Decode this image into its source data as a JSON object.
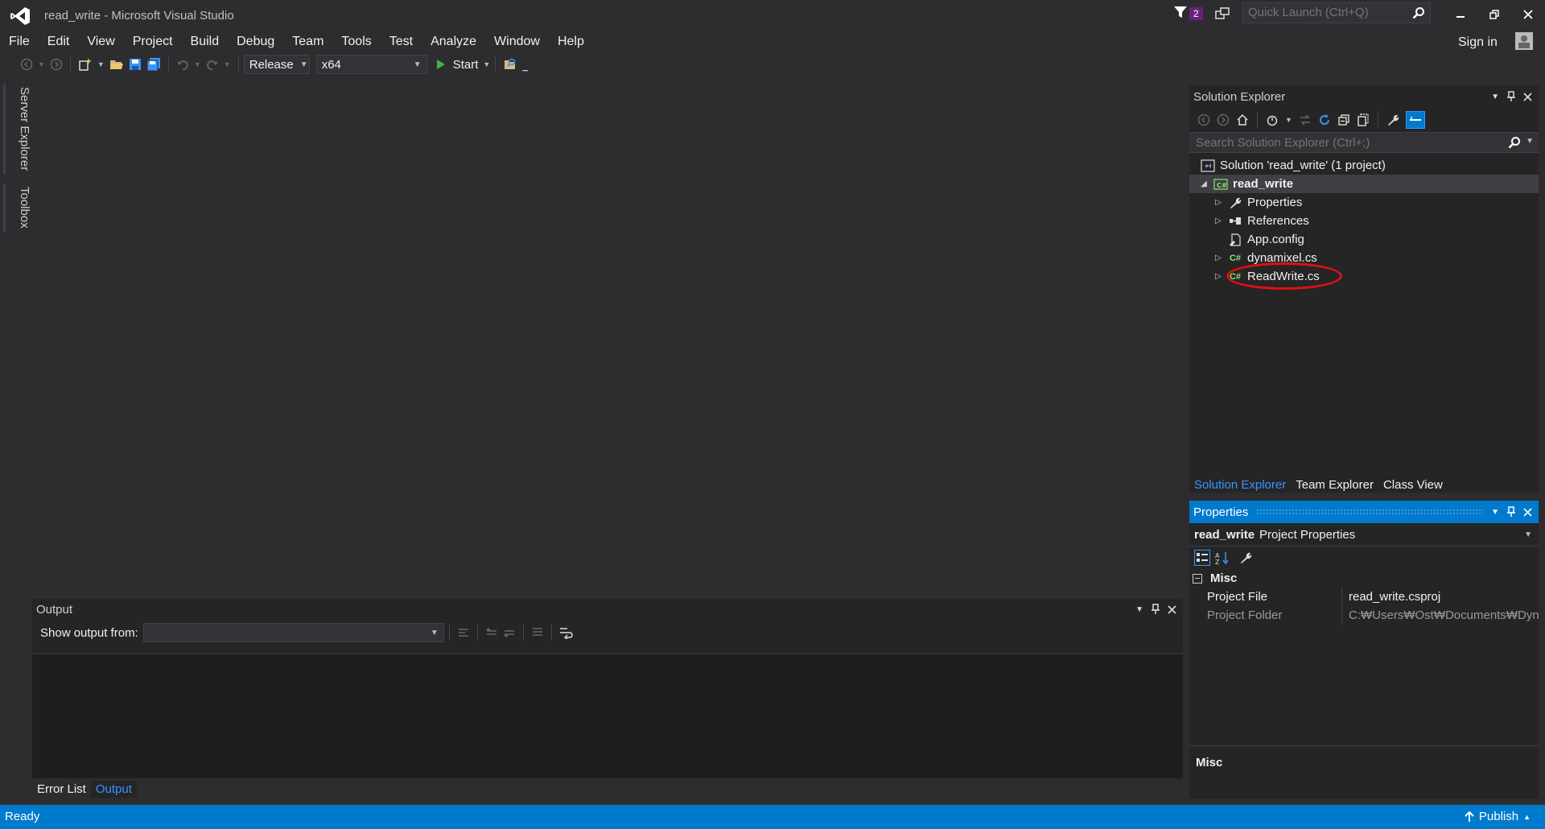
{
  "window": {
    "title": "read_write - Microsoft Visual Studio",
    "notification_count": "2",
    "quick_launch_placeholder": "Quick Launch (Ctrl+Q)",
    "sign_in": "Sign in"
  },
  "menu": {
    "items": [
      "File",
      "Edit",
      "View",
      "Project",
      "Build",
      "Debug",
      "Team",
      "Tools",
      "Test",
      "Analyze",
      "Window",
      "Help"
    ]
  },
  "toolbar": {
    "configuration": "Release",
    "platform": "x64",
    "start_label": "Start"
  },
  "side_tabs": [
    "Server Explorer",
    "Toolbox"
  ],
  "solution_explorer": {
    "title": "Solution Explorer",
    "search_placeholder": "Search Solution Explorer (Ctrl+;)",
    "tree": [
      {
        "label": "Solution 'read_write' (1 project)",
        "icon": "solution-icon"
      },
      {
        "label": "read_write",
        "icon": "csharp-project-icon"
      },
      {
        "label": "Properties",
        "icon": "wrench-icon"
      },
      {
        "label": "References",
        "icon": "references-icon"
      },
      {
        "label": "App.config",
        "icon": "config-file-icon"
      },
      {
        "label": "dynamixel.cs",
        "icon": "csharp-file-icon"
      },
      {
        "label": "ReadWrite.cs",
        "icon": "csharp-file-icon"
      }
    ],
    "bottom_tabs": [
      "Solution Explorer",
      "Team Explorer",
      "Class View"
    ]
  },
  "properties": {
    "title": "Properties",
    "object_name": "read_write",
    "object_type": "Project Properties",
    "category": "Misc",
    "rows": [
      {
        "name": "Project File",
        "value": "read_write.csproj"
      },
      {
        "name": "Project Folder",
        "value": "C:₩Users₩Ost₩Documents₩Dyn"
      }
    ],
    "description_title": "Misc"
  },
  "output": {
    "title": "Output",
    "show_output_from": "Show output from:",
    "bottom_tabs": [
      "Error List",
      "Output"
    ]
  },
  "status": {
    "ready": "Ready",
    "publish": "Publish"
  },
  "colors": {
    "accent": "#007acc",
    "background": "#2d2d30",
    "panel": "#252526",
    "highlight": "#e01010"
  }
}
